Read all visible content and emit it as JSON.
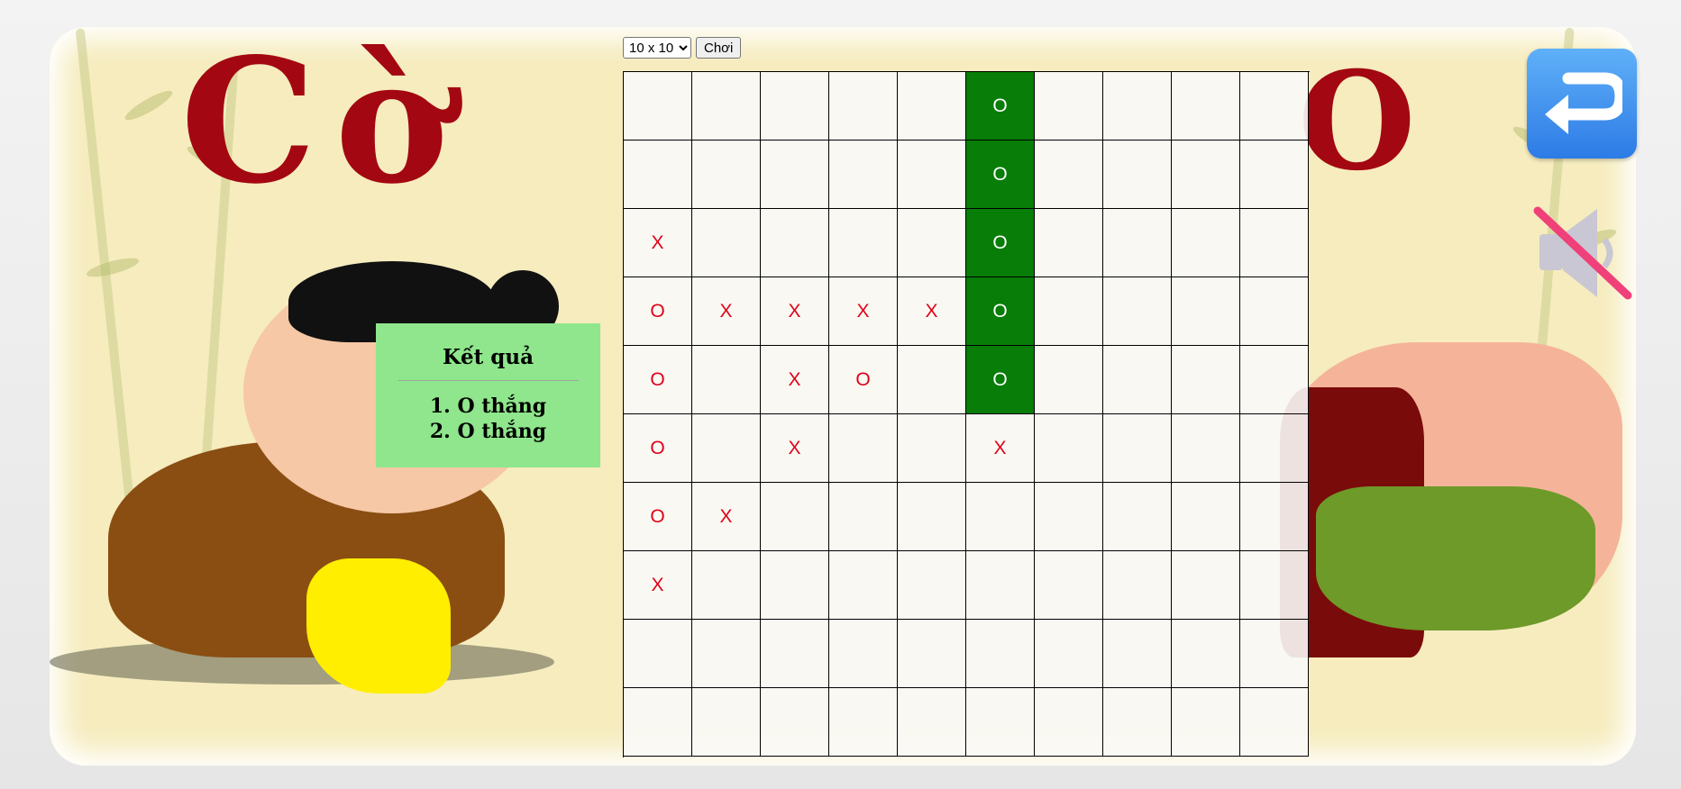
{
  "controls": {
    "size_options": [
      "10 x 10"
    ],
    "size_selected": "10 x 10",
    "play_label": "Chơi"
  },
  "result": {
    "title": "Kết quả",
    "lines": [
      "1. O thắng",
      "2. O thắng"
    ]
  },
  "board": {
    "size": 10,
    "cells": [
      [
        "",
        "",
        "",
        "",
        "",
        "O",
        "",
        "",
        "",
        ""
      ],
      [
        "",
        "",
        "",
        "",
        "",
        "O",
        "",
        "",
        "",
        ""
      ],
      [
        "X",
        "",
        "",
        "",
        "",
        "O",
        "",
        "",
        "",
        ""
      ],
      [
        "O",
        "X",
        "X",
        "X",
        "X",
        "O",
        "",
        "",
        "",
        ""
      ],
      [
        "O",
        "",
        "X",
        "O",
        "",
        "O",
        "",
        "",
        "",
        ""
      ],
      [
        "O",
        "",
        "X",
        "",
        "",
        "X",
        "",
        "",
        "",
        ""
      ],
      [
        "O",
        "X",
        "",
        "",
        "",
        "",
        "",
        "",
        "",
        ""
      ],
      [
        "X",
        "",
        "",
        "",
        "",
        "",
        "",
        "",
        "",
        ""
      ],
      [
        "",
        "",
        "",
        "",
        "",
        "",
        "",
        "",
        "",
        ""
      ],
      [
        "",
        "",
        "",
        "",
        "",
        "",
        "",
        "",
        "",
        ""
      ]
    ],
    "winning_cells": [
      [
        0,
        5
      ],
      [
        1,
        5
      ],
      [
        2,
        5
      ],
      [
        3,
        5
      ],
      [
        4,
        5
      ]
    ]
  },
  "colors": {
    "win_cell": "#087d08",
    "piece": "#e0001a",
    "result_panel": "#8fe68c",
    "back_button": "#2d7be6",
    "mute_slash": "#f0407a"
  },
  "icons": {
    "back": "return-arrow-icon",
    "sound": "speaker-muted-icon"
  }
}
